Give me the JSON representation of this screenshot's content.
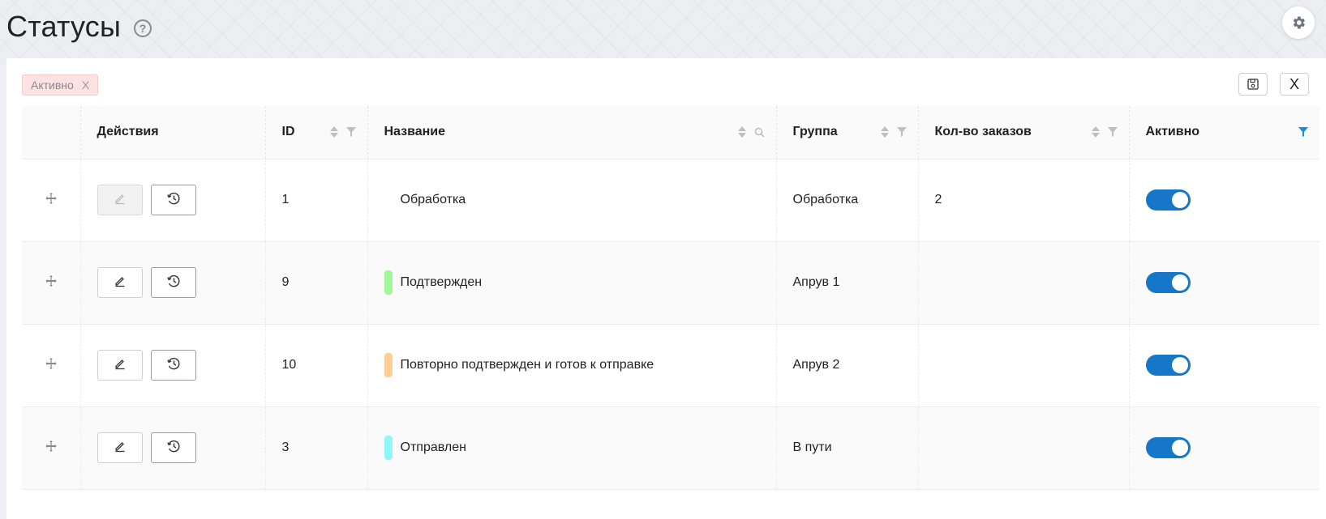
{
  "page": {
    "title": "Статусы",
    "help_icon": "question-circle-icon",
    "settings_icon": "gear-icon"
  },
  "filters": {
    "active_tag": "Активно",
    "remove_glyph": "X",
    "save_icon": "save-icon",
    "close_label": "X"
  },
  "table": {
    "columns": [
      {
        "label": ""
      },
      {
        "label": "Действия"
      },
      {
        "label": "ID"
      },
      {
        "label": "Название"
      },
      {
        "label": "Группа"
      },
      {
        "label": "Кол-во заказов"
      },
      {
        "label": "Активно"
      }
    ],
    "rows": [
      {
        "id": "1",
        "name": "Обработка",
        "color": "",
        "group": "Обработка",
        "orders": "2",
        "active": true,
        "edit_disabled": true
      },
      {
        "id": "9",
        "name": "Подтвержден",
        "color": "#a3f79b",
        "group": "Апрув 1",
        "orders": "",
        "active": true,
        "edit_disabled": false
      },
      {
        "id": "10",
        "name": "Повторно подтвержден и готов к отправке",
        "color": "#fdcf94",
        "group": "Апрув 2",
        "orders": "",
        "active": true,
        "edit_disabled": false
      },
      {
        "id": "3",
        "name": "Отправлен",
        "color": "#8ff7f7",
        "group": "В пути",
        "orders": "",
        "active": true,
        "edit_disabled": false
      }
    ]
  },
  "colors": {
    "accent": "#1677c9",
    "active_filter": "#1a8fd6",
    "tag_bg": "#fde2e2"
  }
}
